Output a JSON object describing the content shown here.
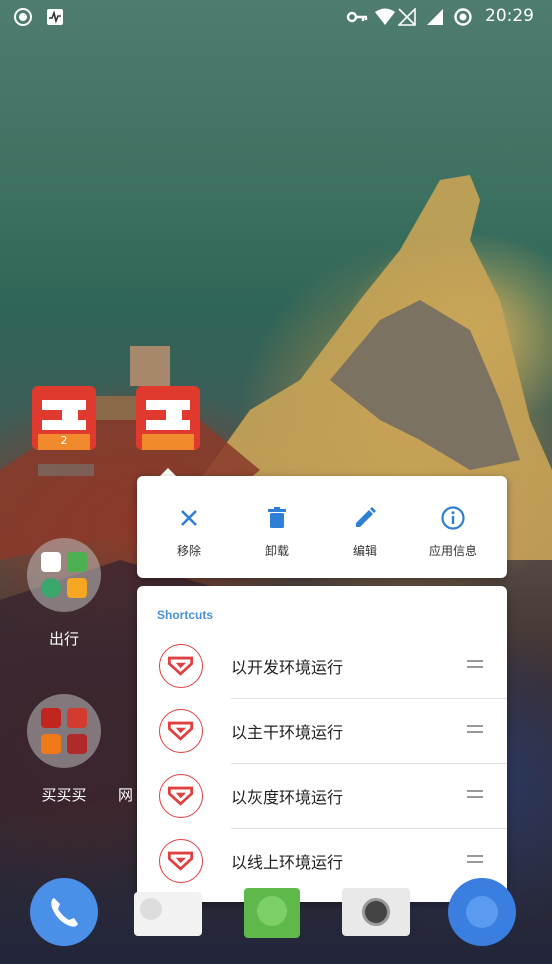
{
  "status_bar": {
    "time": "20:29"
  },
  "home": {
    "selected_app_badge": "2",
    "folders": [
      {
        "label": "出行"
      },
      {
        "label": "买买买"
      },
      {
        "label": "网"
      }
    ]
  },
  "actions": [
    {
      "label": "移除",
      "icon": "close-icon"
    },
    {
      "label": "卸载",
      "icon": "trash-icon"
    },
    {
      "label": "编辑",
      "icon": "pencil-icon"
    },
    {
      "label": "应用信息",
      "icon": "info-icon"
    }
  ],
  "shortcuts": {
    "title": "Shortcuts",
    "items": [
      {
        "label": "以开发环境运行"
      },
      {
        "label": "以主干环境运行"
      },
      {
        "label": "以灰度环境运行"
      },
      {
        "label": "以线上环境运行"
      }
    ]
  },
  "colors": {
    "accent": "#4a90d9",
    "icon_red": "#e04040",
    "action_blue": "#2f7fd6"
  }
}
